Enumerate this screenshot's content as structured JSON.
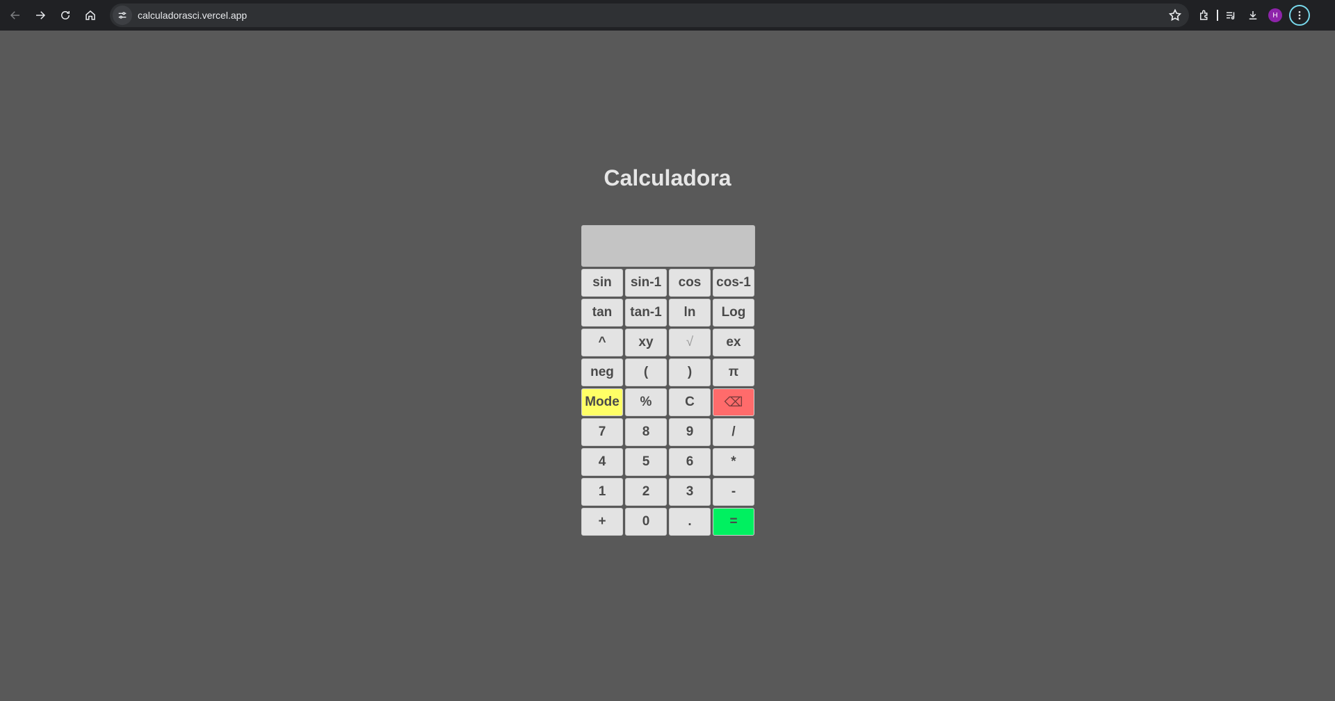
{
  "browser": {
    "url": "calculadorasci.vercel.app",
    "avatar_initial": "H",
    "icons": [
      "back-icon",
      "forward-icon",
      "reload-icon",
      "home-icon",
      "site-info-icon",
      "bookmark-star-icon",
      "extensions-icon",
      "media-queue-icon",
      "download-icon",
      "avatar",
      "kebab-menu-icon"
    ]
  },
  "page": {
    "title": "Calculadora"
  },
  "calculator": {
    "display_value": "",
    "keys": [
      {
        "label": "sin",
        "name": "key-sin"
      },
      {
        "label": "sin-1",
        "name": "key-asin"
      },
      {
        "label": "cos",
        "name": "key-cos"
      },
      {
        "label": "cos-1",
        "name": "key-acos"
      },
      {
        "label": "tan",
        "name": "key-tan"
      },
      {
        "label": "tan-1",
        "name": "key-atan"
      },
      {
        "label": "ln",
        "name": "key-ln"
      },
      {
        "label": "Log",
        "name": "key-log"
      },
      {
        "label": "^",
        "name": "key-caret"
      },
      {
        "label": "xy",
        "name": "key-power"
      },
      {
        "label": "√",
        "name": "key-sqrt"
      },
      {
        "label": "ex",
        "name": "key-exp"
      },
      {
        "label": "neg",
        "name": "key-neg"
      },
      {
        "label": "(",
        "name": "key-open-paren"
      },
      {
        "label": ")",
        "name": "key-close-paren"
      },
      {
        "label": "π",
        "name": "key-pi"
      },
      {
        "label": "Mode",
        "name": "key-mode"
      },
      {
        "label": "%",
        "name": "key-percent"
      },
      {
        "label": "C",
        "name": "key-clear"
      },
      {
        "label": "⌫",
        "name": "key-backspace"
      },
      {
        "label": "7",
        "name": "key-7"
      },
      {
        "label": "8",
        "name": "key-8"
      },
      {
        "label": "9",
        "name": "key-9"
      },
      {
        "label": "/",
        "name": "key-divide"
      },
      {
        "label": "4",
        "name": "key-4"
      },
      {
        "label": "5",
        "name": "key-5"
      },
      {
        "label": "6",
        "name": "key-6"
      },
      {
        "label": "*",
        "name": "key-multiply"
      },
      {
        "label": "1",
        "name": "key-1"
      },
      {
        "label": "2",
        "name": "key-2"
      },
      {
        "label": "3",
        "name": "key-3"
      },
      {
        "label": "-",
        "name": "key-minus"
      },
      {
        "label": "+",
        "name": "key-plus"
      },
      {
        "label": "0",
        "name": "key-0"
      },
      {
        "label": ".",
        "name": "key-decimal"
      },
      {
        "label": "=",
        "name": "key-equals"
      }
    ],
    "colors": {
      "mode": "#ffff66",
      "backspace": "#ff6b6b",
      "equals": "#00f060",
      "key": "#e3e3e3",
      "display": "#c4c4c4",
      "page_background": "#595959"
    }
  }
}
